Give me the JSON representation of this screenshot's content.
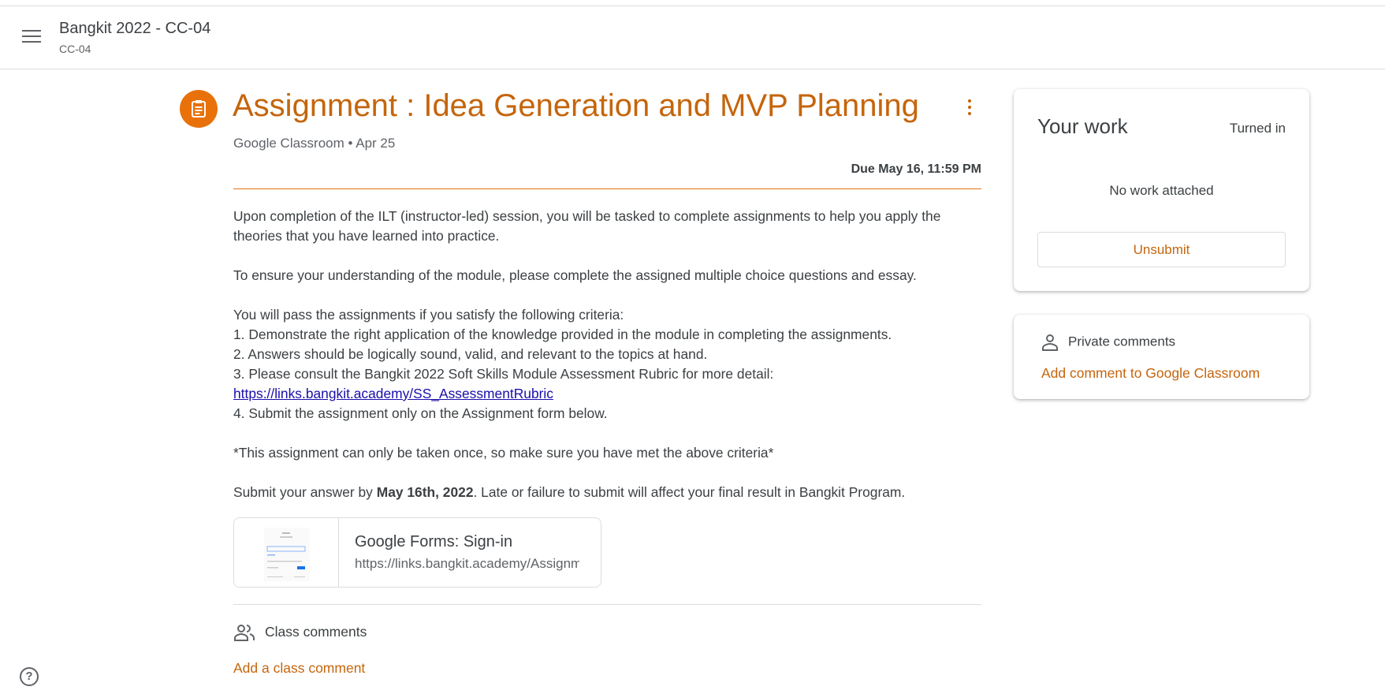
{
  "header": {
    "title": "Bangkit 2022 - CC-04",
    "subtitle": "CC-04"
  },
  "assignment": {
    "title": "Assignment : Idea Generation and MVP Planning",
    "meta": "Google Classroom • Apr 25",
    "due": "Due May 16, 11:59 PM",
    "accent_color": "#e8710a",
    "body": {
      "p1": "Upon completion of the ILT (instructor-led) session, you will be tasked to complete assignments to help you apply the theories that you have learned into practice.",
      "p2": "To ensure your understanding of the module, please complete the assigned multiple choice questions and essay.",
      "p3": "You will pass the assignments if you satisfy the following criteria:",
      "c1": "1. Demonstrate the right application of the knowledge provided in the module in completing the assignments.",
      "c2": "2. Answers should be logically sound, valid, and relevant to the topics at hand.",
      "c3": "3. Please consult the Bangkit 2022 Soft Skills Module Assessment Rubric for more detail:",
      "link": "https://links.bangkit.academy/SS_AssessmentRubric",
      "c4": "4. Submit the assignment only on the Assignment form below.",
      "note": "*This assignment can only be taken once, so make sure you have met the above criteria*",
      "submit_pre": "Submit your answer by ",
      "submit_bold": "May 16th, 2022",
      "submit_post": ". Late or failure to submit will affect your final result in Bangkit Program."
    },
    "attachment": {
      "title": "Google Forms: Sign-in",
      "url": "https://links.bangkit.academy/Assignment"
    },
    "class_comments": "Class comments",
    "add_class_comment": "Add a class comment"
  },
  "your_work": {
    "title": "Your work",
    "status": "Turned in",
    "empty": "No work attached",
    "unsubmit": "Unsubmit"
  },
  "private_comments": {
    "title": "Private comments",
    "add": "Add comment to Google Classroom"
  },
  "help_label": "?"
}
